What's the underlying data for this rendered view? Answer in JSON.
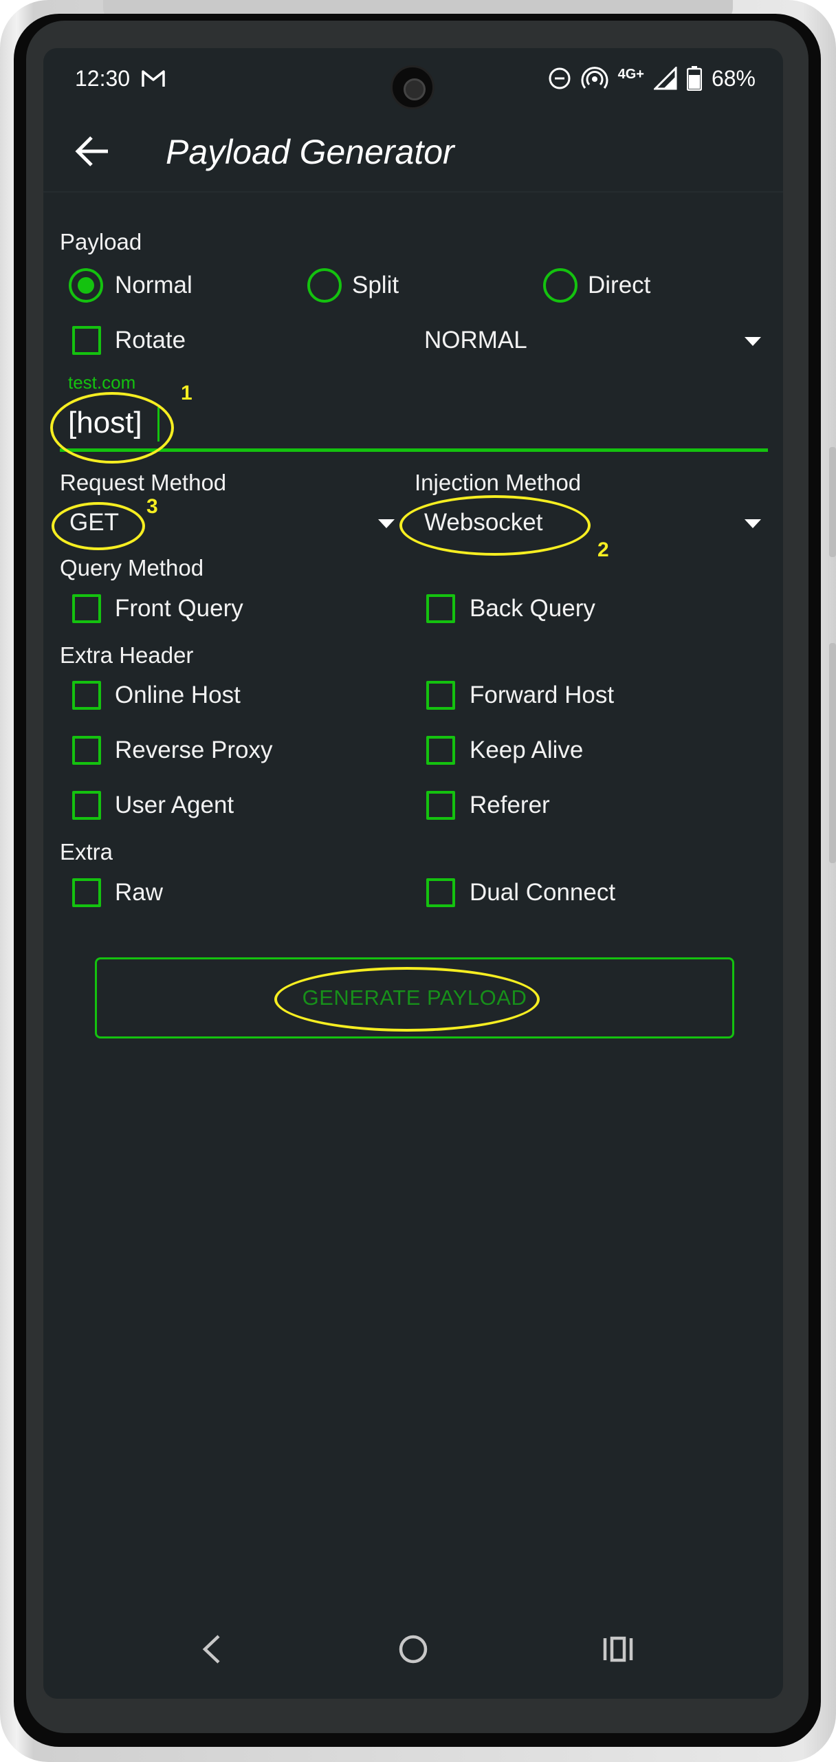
{
  "status_bar": {
    "time": "12:30",
    "network": "4G+",
    "battery": "68%",
    "icons": [
      "gmail-icon",
      "do-not-disturb-icon",
      "hotspot-icon",
      "signal-icon",
      "battery-icon"
    ]
  },
  "app_bar": {
    "title": "Payload Generator",
    "back_icon": "arrow-left-icon"
  },
  "payload": {
    "label": "Payload",
    "options": [
      "Normal",
      "Split",
      "Direct"
    ],
    "selected": "Normal",
    "rotate_label": "Rotate",
    "mode_value": "NORMAL"
  },
  "host_input": {
    "hint": "test.com",
    "value": "[host]"
  },
  "request_method": {
    "label": "Request Method",
    "value": "GET"
  },
  "injection_method": {
    "label": "Injection Method",
    "value": "Websocket"
  },
  "query_method": {
    "label": "Query Method",
    "front": "Front Query",
    "back": "Back Query"
  },
  "extra_header": {
    "label": "Extra Header",
    "items": [
      "Online Host",
      "Forward Host",
      "Reverse Proxy",
      "Keep Alive",
      "User Agent",
      "Referer"
    ]
  },
  "extra": {
    "label": "Extra",
    "items": [
      "Raw",
      "Dual Connect"
    ]
  },
  "generate_button": "GENERATE PAYLOAD",
  "annotations": [
    "1",
    "2",
    "3"
  ],
  "colors": {
    "accent": "#14c20f",
    "screen_bg": "#1f2528",
    "annotation": "#f6ee21",
    "button_text": "#17901a"
  },
  "nav_bar": {
    "icons": [
      "nav-back-icon",
      "nav-home-icon",
      "nav-recents-icon"
    ]
  }
}
